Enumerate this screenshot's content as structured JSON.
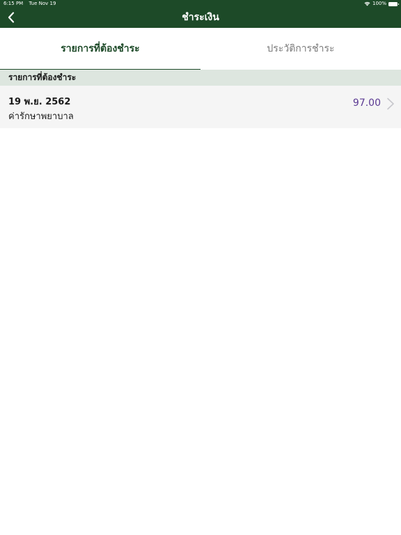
{
  "status_bar": {
    "time": "6:15 PM",
    "date": "Tue Nov 19",
    "battery": "100%"
  },
  "nav": {
    "title": "ชำระเงิน",
    "back_icon": "chevron-left-icon"
  },
  "tabs": [
    {
      "label": "รายการที่ต้องชำระ",
      "active": true
    },
    {
      "label": "ประวัติการชำระ",
      "active": false
    }
  ],
  "section": {
    "header": "รายการที่ต้องชำระ"
  },
  "items": [
    {
      "date": "19 พ.ย. 2562",
      "description": "ค่ารักษาพยาบาล",
      "amount": "97.00"
    }
  ],
  "colors": {
    "brand": "#1d4a28",
    "section_bg": "#dde6df",
    "amount": "#5b3a93"
  }
}
